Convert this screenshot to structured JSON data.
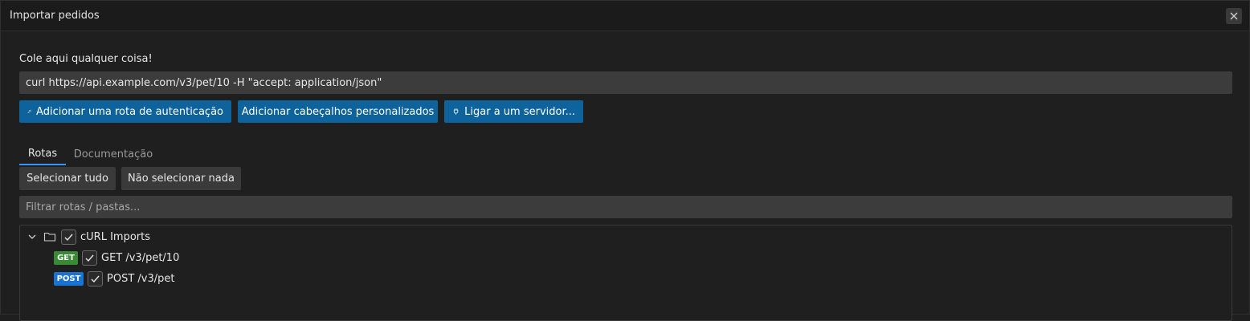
{
  "window": {
    "title": "Importar pedidos"
  },
  "hint": "Cole aqui qualquer coisa!",
  "curl_input": {
    "value": "curl https://api.example.com/v3/pet/10 -H \"accept: application/json\""
  },
  "actions": {
    "auth_label": "Adicionar uma rota de autenticação",
    "headers_label": "Adicionar cabeçalhos personalizados",
    "server_label": "Ligar a um servidor..."
  },
  "tabs": [
    {
      "label": "Rotas",
      "active": true
    },
    {
      "label": "Documentação",
      "active": false
    }
  ],
  "selection": {
    "select_all": "Selecionar tudo",
    "select_none": "Não selecionar nada"
  },
  "filter": {
    "placeholder": "Filtrar rotas / pastas..."
  },
  "tree": {
    "folder": {
      "label": "cURL Imports",
      "checked": true,
      "expanded": true
    },
    "routes": [
      {
        "method": "GET",
        "path": "GET /v3/pet/10",
        "checked": true
      },
      {
        "method": "POST",
        "path": "POST /v3/pet",
        "checked": true
      }
    ]
  },
  "colors": {
    "primary_button": "#0e639c",
    "get_badge": "#388a34",
    "post_badge": "#1a73d1",
    "active_tab_underline": "#3794ff"
  },
  "icons": {
    "close": "close-icon",
    "auth": "key-icon",
    "server": "plug-icon",
    "expand": "chevron-down-icon",
    "folder": "folder-icon",
    "check": "check-icon"
  }
}
